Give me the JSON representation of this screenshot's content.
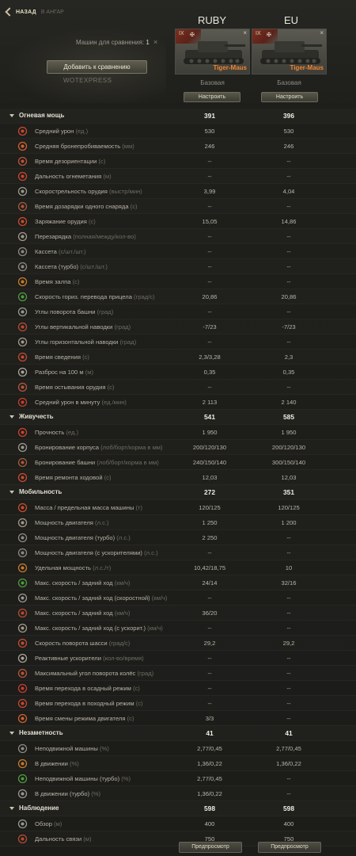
{
  "header": {
    "back_label": "НАЗАД",
    "back_sub": "В АНГАР",
    "col1_title": "RUBY",
    "col2_title": "EU",
    "compare_label": "Машин для сравнения:",
    "compare_count": "1",
    "close_glyph": "×",
    "add_button": "Добавить к сравнению",
    "watermark": "WOTEXPRESS"
  },
  "tanks": [
    {
      "tier": "IX",
      "name": "Tiger-Maus",
      "base_label": "Базовая",
      "configure": "Настроить",
      "close": "×",
      "nation_color": "#7a2f22"
    },
    {
      "tier": "IX",
      "name": "Tiger-Maus",
      "base_label": "Базовая",
      "configure": "Настроить",
      "close": "×",
      "nation_color": "#7a2f22"
    }
  ],
  "sections": [
    {
      "title": "Огневая мощь",
      "v1": "391",
      "v2": "396",
      "rows": [
        {
          "icon": "damage-icon",
          "label": "Средний урон",
          "unit": "(ед.)",
          "v1": "530",
          "v2": "530"
        },
        {
          "icon": "penetration-icon",
          "label": "Средняя бронепробиваемость",
          "unit": "(мм)",
          "v1": "246",
          "v2": "246"
        },
        {
          "icon": "stun-icon",
          "label": "Время дезориентации",
          "unit": "(с)",
          "v1": "--",
          "v2": "--"
        },
        {
          "icon": "flame-range-icon",
          "label": "Дальность огнеметания",
          "unit": "(м)",
          "v1": "--",
          "v2": "--"
        },
        {
          "icon": "rate-of-fire-icon",
          "label": "Скорострельность орудия",
          "unit": "(выстр/мин)",
          "v1": "3,99",
          "v2": "4,04"
        },
        {
          "icon": "shell-reload-icon",
          "label": "Время дозарядки одного снаряда",
          "unit": "(с)",
          "v1": "--",
          "v2": "--"
        },
        {
          "icon": "reload-icon",
          "label": "Заряжание орудия",
          "unit": "(с)",
          "v1": "15,05",
          "v2": "14,86"
        },
        {
          "icon": "autoreload-icon",
          "label": "Перезарядка",
          "unit": "(полная/между/кол-во)",
          "v1": "--",
          "v2": "--"
        },
        {
          "icon": "clip-icon",
          "label": "Кассета",
          "unit": "(с/шт./шт.)",
          "v1": "--",
          "v2": "--"
        },
        {
          "icon": "clip-turbo-icon",
          "label": "Кассета (турбо)",
          "unit": "(с/шт./шт.)",
          "v1": "--",
          "v2": "--"
        },
        {
          "icon": "salvo-icon",
          "label": "Время залпа",
          "unit": "(с)",
          "v1": "--",
          "v2": "--"
        },
        {
          "icon": "traverse-aim-icon",
          "label": "Скорость гориз. перевода прицела",
          "unit": "(град/с)",
          "v1": "20,86",
          "v2": "20,86"
        },
        {
          "icon": "turret-angle-icon",
          "label": "Углы поворота башни",
          "unit": "(град)",
          "v1": "--",
          "v2": "--"
        },
        {
          "icon": "elevation-icon",
          "label": "Углы вертикальной наводки",
          "unit": "(град)",
          "v1": "-7/23",
          "v2": "-7/23"
        },
        {
          "icon": "horizontal-aim-icon",
          "label": "Углы горизонтальной наводки",
          "unit": "(град)",
          "v1": "--",
          "v2": "--"
        },
        {
          "icon": "aim-time-icon",
          "label": "Время сведения",
          "unit": "(с)",
          "v1": "2,3/3,28",
          "v2": "2,3"
        },
        {
          "icon": "dispersion-icon",
          "label": "Разброс на 100 м",
          "unit": "(м)",
          "v1": "0,35",
          "v2": "0,35"
        },
        {
          "icon": "cooling-icon",
          "label": "Время остывания орудия",
          "unit": "(с)",
          "v1": "--",
          "v2": "--"
        },
        {
          "icon": "dpm-icon",
          "label": "Средний урон в минуту",
          "unit": "(ед./мин)",
          "v1": "2 113",
          "v2": "2 140"
        }
      ]
    },
    {
      "title": "Живучесть",
      "v1": "541",
      "v2": "585",
      "rows": [
        {
          "icon": "hp-icon",
          "label": "Прочность",
          "unit": "(ед.)",
          "v1": "1 950",
          "v2": "1 950"
        },
        {
          "icon": "hull-armor-icon",
          "label": "Бронирование корпуса",
          "unit": "(лоб/борт/корма в мм)",
          "v1": "200/120/130",
          "v2": "200/120/130"
        },
        {
          "icon": "turret-armor-icon",
          "label": "Бронирование башни",
          "unit": "(лоб/борт/корма в мм)",
          "v1": "240/150/140",
          "v2": "300/150/140"
        },
        {
          "icon": "repair-icon",
          "label": "Время ремонта ходовой",
          "unit": "(с)",
          "v1": "12,03",
          "v2": "12,03"
        }
      ]
    },
    {
      "title": "Мобильность",
      "v1": "272",
      "v2": "351",
      "rows": [
        {
          "icon": "weight-icon",
          "label": "Масса / предельная масса машины",
          "unit": "(т)",
          "v1": "120/125",
          "v2": "120/125"
        },
        {
          "icon": "engine-icon",
          "label": "Мощность двигателя",
          "unit": "(л.с.)",
          "v1": "1 250",
          "v2": "1 200"
        },
        {
          "icon": "engine-turbo-icon",
          "label": "Мощность двигателя (турбо)",
          "unit": "(л.с.)",
          "v1": "2 250",
          "v2": "--"
        },
        {
          "icon": "engine-boost-icon",
          "label": "Мощность двигателя (с ускорителями)",
          "unit": "(л.с.)",
          "v1": "--",
          "v2": "--"
        },
        {
          "icon": "specific-power-icon",
          "label": "Удельная мощность",
          "unit": "(л.с./т)",
          "v1": "10,42/18,75",
          "v2": "10"
        },
        {
          "icon": "speed-icon",
          "label": "Макс. скорость / задний ход",
          "unit": "(км/ч)",
          "v1": "24/14",
          "v2": "32/16"
        },
        {
          "icon": "speed-fast-icon",
          "label": "Макс. скорость / задний ход (скоростной)",
          "unit": "(км/ч)",
          "v1": "--",
          "v2": "--"
        },
        {
          "icon": "speed-turbo-icon",
          "label": "Макс. скорость / задний ход",
          "unit": "(км/ч)",
          "v1": "36/20",
          "v2": "--"
        },
        {
          "icon": "speed-boost-icon",
          "label": "Макс. скорость / задний ход (с ускорит.)",
          "unit": "(км/ч)",
          "v1": "--",
          "v2": "--"
        },
        {
          "icon": "chassis-traverse-icon",
          "label": "Скорость поворота шасси",
          "unit": "(град/с)",
          "v1": "29,2",
          "v2": "29,2"
        },
        {
          "icon": "rocket-boost-icon",
          "label": "Реактивные ускорители",
          "unit": "(кол-во/время)",
          "v1": "--",
          "v2": "--"
        },
        {
          "icon": "wheel-angle-icon",
          "label": "Максимальный угол поворота колёс",
          "unit": "(град)",
          "v1": "--",
          "v2": "--"
        },
        {
          "icon": "siege-icon",
          "label": "Время перехода в осадный режим",
          "unit": "(с)",
          "v1": "--",
          "v2": "--"
        },
        {
          "icon": "travel-mode-icon",
          "label": "Время перехода в походный режим",
          "unit": "(с)",
          "v1": "--",
          "v2": "--"
        },
        {
          "icon": "engine-mode-icon",
          "label": "Время смены режима двигателя",
          "unit": "(с)",
          "v1": "3/3",
          "v2": "--"
        }
      ]
    },
    {
      "title": "Незаметность",
      "v1": "41",
      "v2": "41",
      "rows": [
        {
          "icon": "camo-stationary-icon",
          "label": "Неподвижной машины",
          "unit": "(%)",
          "v1": "2,77/0,45",
          "v2": "2,77/0,45"
        },
        {
          "icon": "camo-moving-icon",
          "label": "В движении",
          "unit": "(%)",
          "v1": "1,36/0,22",
          "v2": "1,36/0,22"
        },
        {
          "icon": "camo-stationary-turbo-icon",
          "label": "Неподвижной машины (турбо)",
          "unit": "(%)",
          "v1": "2,77/0,45",
          "v2": "--"
        },
        {
          "icon": "camo-moving-turbo-icon",
          "label": "В движении (турбо)",
          "unit": "(%)",
          "v1": "1,36/0,22",
          "v2": "--"
        }
      ]
    },
    {
      "title": "Наблюдение",
      "v1": "598",
      "v2": "598",
      "rows": [
        {
          "icon": "view-range-icon",
          "label": "Обзор",
          "unit": "(м)",
          "v1": "400",
          "v2": "400"
        },
        {
          "icon": "radio-range-icon",
          "label": "Дальность связи",
          "unit": "(м)",
          "v1": "750",
          "v2": "750"
        }
      ]
    }
  ],
  "footer": {
    "preview1": "Предпросмотр",
    "preview2": "Предпросмотр"
  }
}
